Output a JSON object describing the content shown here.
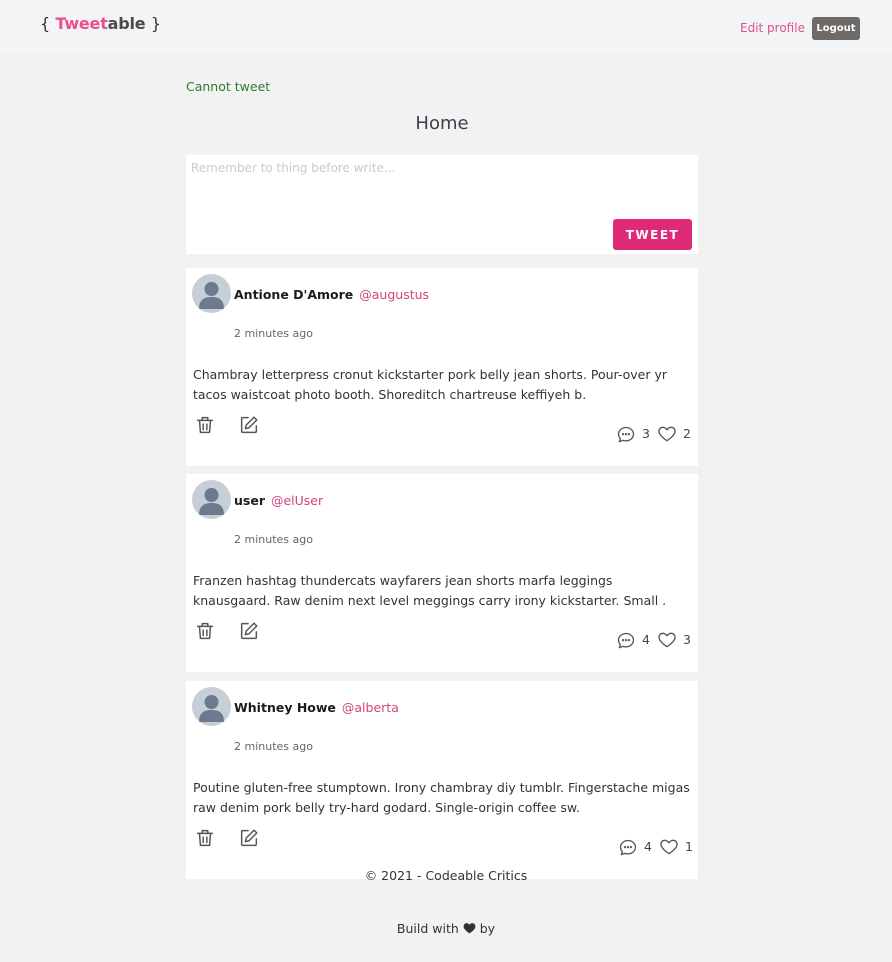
{
  "header": {
    "logo_open": "{",
    "logo_pink": "Tweet",
    "logo_dark": "able",
    "logo_close": "}",
    "edit_profile_label": "Edit profile",
    "logout_label": "Logout"
  },
  "notice": "Cannot tweet",
  "page_title": "Home",
  "composer": {
    "placeholder": "Remember to thing before write...",
    "value": "",
    "button_label": "TWEET"
  },
  "tweets": [
    {
      "name": "Antione D'Amore",
      "handle": "@augustus",
      "time": "2 minutes ago",
      "body": "Chambray letterpress cronut kickstarter pork belly jean shorts. Pour-over yr tacos waistcoat photo booth. Shoreditch chartreuse keffiyeh b.",
      "comments": "3",
      "likes": "2"
    },
    {
      "name": "user",
      "handle": "@elUser",
      "time": "2 minutes ago",
      "body": "Franzen hashtag thundercats wayfarers jean shorts marfa leggings knausgaard. Raw denim next level meggings carry irony kickstarter. Small .",
      "comments": "4",
      "likes": "3"
    },
    {
      "name": "Whitney Howe",
      "handle": "@alberta",
      "time": "2 minutes ago",
      "body": "Poutine gluten-free stumptown. Irony chambray diy tumblr. Fingerstache migas raw denim pork belly try-hard godard. Single-origin coffee sw.",
      "comments": "4",
      "likes": "1"
    }
  ],
  "footer": {
    "copyright": "© 2021 - Codeable Critics",
    "build_prefix": "Build with",
    "build_suffix": "by",
    "heart_icon": "heart-icon"
  },
  "colors": {
    "accent": "#df2a77",
    "handle": "#d2437f",
    "notice": "#2e7d32",
    "logout_bg": "#6e6a67"
  }
}
